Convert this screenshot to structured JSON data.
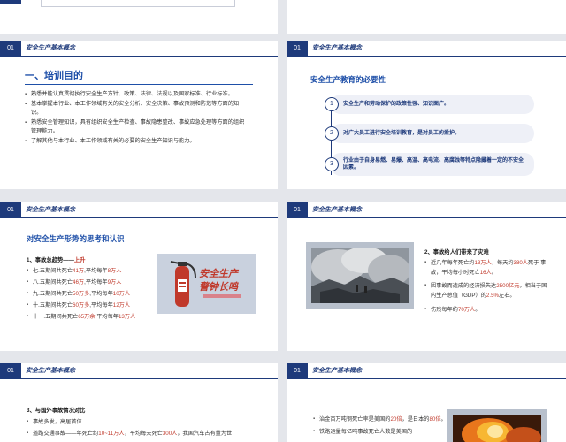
{
  "header_title": "安全生产基本概念",
  "slide_num": "01",
  "s1": {
    "title": "一、培训目的",
    "items": [
      "熟悉并能认真贯彻执行安全生产方针、政策、法律、法规以及国家标准、行业标准。",
      "基本掌握本行业、本工作领域有关的安全分析、安全决策、事故预测和防范等方面的知识。",
      "熟悉安全管理知识，具有组织安全生产检查、事故隐患整改、事故应急处理等方面的组织管理能力。",
      "了解其他与本行业、本工作领域有关的必要的安全生产知识与能力。"
    ]
  },
  "s2": {
    "title": "安全生产教育的必要性",
    "items": [
      {
        "num": "1",
        "text": "安全生产和劳动保护的政策性强、知识面广。"
      },
      {
        "num": "2",
        "text": "对广大员工进行安全培训教育，是对员工的爱护。"
      },
      {
        "num": "3",
        "text": "行业由于自身易燃、易爆、高温、高电流、高腐蚀等特点隐藏着一定的不安全因素。"
      }
    ]
  },
  "s3": {
    "title": "对安全生产形势的思考和认识",
    "subtitle_prefix": "1、事故总趋势——",
    "subtitle_trend": "上升",
    "items": [
      {
        "prefix": "七.五期间共死亡",
        "a": "41万",
        "mid": ",平均每年",
        "b": "8万人"
      },
      {
        "prefix": "八.五期间共死亡",
        "a": "46万",
        "mid": ",平均每年",
        "b": "9万人"
      },
      {
        "prefix": "九.五期间共死亡",
        "a": "50万多",
        "mid": ",平均每年",
        "b": "10万人"
      },
      {
        "prefix": "十.五期间共死亡",
        "a": "60万多",
        "mid": ",平均每年",
        "b": "12万人"
      },
      {
        "prefix": "十一.五期间共死亡",
        "a": "65万余",
        "mid": ",平均每年",
        "b": "13万人"
      }
    ],
    "banner_line1": "安全生产",
    "banner_line2": "警钟长鸣"
  },
  "s4": {
    "subtitle": "2、事故给人们带来了灾难",
    "items": [
      {
        "parts": [
          "近几年每年死亡约",
          "13万人",
          "，每天约",
          "380人",
          "死于 事故，平均每小时死亡",
          "16人",
          "。"
        ]
      },
      {
        "parts": [
          "因事故而造成的经济损失达",
          "2500亿元",
          "，相当于国内生产总值（GDP）的",
          "2.5%",
          "左右。"
        ]
      },
      {
        "parts": [
          "伤残每年约",
          "70万人",
          "。"
        ]
      }
    ]
  },
  "s5": {
    "subtitle": "3、与国外事故情况对比",
    "items": [
      {
        "parts": [
          "事故多发，高居首位"
        ]
      },
      {
        "parts": [
          "道路交通事故——年死亡约",
          "10~11万人",
          "，平均每天死亡",
          "300人",
          "，我国汽车占有量为世"
        ]
      }
    ]
  },
  "s6": {
    "items": [
      {
        "parts": [
          "治金百万吨钢死亡率是美国的",
          "20倍",
          "，是日本的",
          "80倍",
          "。"
        ]
      },
      {
        "parts": [
          "铁路运量每亿吨事故死亡人数是美国的"
        ]
      }
    ]
  }
}
